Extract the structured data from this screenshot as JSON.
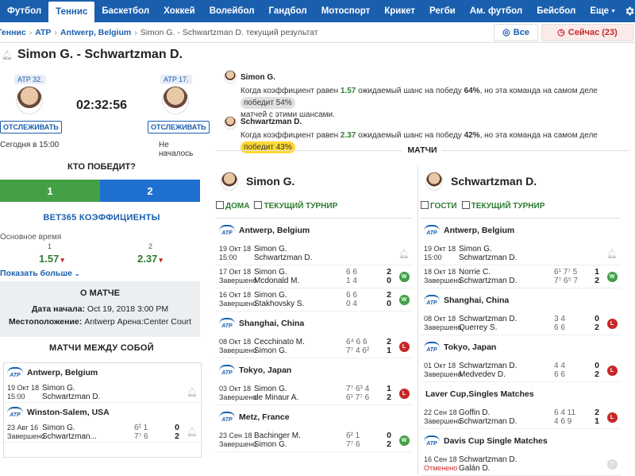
{
  "nav": {
    "tabs": [
      "Футбол",
      "Теннис",
      "Баскетбол",
      "Хоккей",
      "Волейбол",
      "Гандбол",
      "Мотоспорт",
      "Крикет",
      "Регби",
      "Ам. футбол",
      "Бейсбол",
      "Еще"
    ],
    "active": "Теннис",
    "more_icon": "caret-down-icon",
    "settings_icon": "gear-icon"
  },
  "breadcrumb": {
    "items": [
      "Теннис",
      "ATP",
      "Antwerp, Belgium"
    ],
    "current": "Simon G. - Schwartzman D. текущий результат"
  },
  "filters": {
    "all": "Все",
    "now": "Сейчас (23)"
  },
  "match": {
    "title": "Simon G. - Schwartzman D.",
    "time": "02:32:56",
    "home": {
      "rank": "ATP 32.",
      "follow": "ОТСЛЕЖИВАТЬ",
      "status": "Сегодня в 15:00"
    },
    "away": {
      "rank": "ATP 17.",
      "follow": "ОТСЛЕЖИВАТЬ",
      "status": "Не началось"
    }
  },
  "vote": {
    "title": "КТО ПОБЕДИТ?",
    "opt1": "1",
    "opt2": "2"
  },
  "odds": {
    "title": "BET365 КОЭФФИЦИЕНТЫ",
    "market": "Основное время",
    "h1": "1",
    "h2": "2",
    "v1": "1.57",
    "v2": "2.37",
    "show_more": "Показать больше"
  },
  "about": {
    "title": "О МАТЧЕ",
    "start_label": "Дата начала:",
    "start_value": "Oct 19, 2018 3:00 PM",
    "place_label": "Местоположение:",
    "place_value": "Antwerp Арена:Center Court"
  },
  "h2h": {
    "title": "МАТЧИ МЕЖДУ СОБОЙ",
    "groups": [
      {
        "tournament": "Antwerp, Belgium",
        "matches": [
          {
            "date": "19 Окт 18",
            "status": "15:00",
            "p1": "Simon G.",
            "p2": "Schwartzman D.",
            "s1": "",
            "s2": "",
            "t1": "",
            "t2": "",
            "res": "bell"
          }
        ]
      },
      {
        "tournament": "Winston-Salem, USA",
        "matches": [
          {
            "date": "23 Авг 16",
            "status": "Завершено",
            "p1": "Simon G.",
            "p2": "Schwartzman...",
            "s1": "6² 1",
            "s2": "7⁷ 6",
            "t1": "0",
            "t2": "2",
            "res": "bell"
          }
        ]
      }
    ]
  },
  "predictions": {
    "home": {
      "name": "Simon G.",
      "pre": "Когда коэффициент равен ",
      "odd": "1.57",
      "mid": " ожидаемый шанс на победу ",
      "chance": "64%",
      "post": ", но эта команда на самом деле ",
      "pill": "победит 54%",
      "tail": "матчей с этими шансами."
    },
    "away": {
      "name": "Schwartzman D.",
      "pre": "Когда коэффициент равен ",
      "odd": "2.37",
      "mid": " ожидаемый шанс на победу ",
      "chance": "42%",
      "post": ", но эта команда на самом деле ",
      "pill": "победит 43%"
    }
  },
  "matches_title": "МАТЧИ",
  "form": {
    "home": {
      "name": "Simon G.",
      "f1": "ДОМА",
      "f2": "ТЕКУЩИЙ ТУРНИР",
      "groups": [
        {
          "tournament": "Antwerp, Belgium",
          "matches": [
            {
              "date": "19 Окт 18",
              "status": "15:00",
              "p1": "Simon G.",
              "p2": "Schwartzman D.",
              "s1": "",
              "s2": "",
              "t1": "",
              "t2": "",
              "res": "bell"
            },
            {
              "date": "17 Окт 18",
              "status": "Завершено",
              "p1": "Simon G.",
              "p2": "Mcdonald M.",
              "s1": "6 6",
              "s2": "1 4",
              "t1": "2",
              "t2": "0",
              "res": "W"
            },
            {
              "date": "16 Окт 18",
              "status": "Завершено",
              "p1": "Simon G.",
              "p2": "Stakhovsky S.",
              "s1": "6 6",
              "s2": "0 4",
              "t1": "2",
              "t2": "0",
              "res": "W"
            }
          ]
        },
        {
          "tournament": "Shanghai, China",
          "matches": [
            {
              "date": "08 Окт 18",
              "status": "Завершено",
              "p1": "Cecchinato M.",
              "p2": "Simon G.",
              "s1": "6⁴ 6 6",
              "s2": "7⁷ 4 6²",
              "t1": "2",
              "t2": "1",
              "res": "L"
            }
          ]
        },
        {
          "tournament": "Tokyo, Japan",
          "matches": [
            {
              "date": "03 Окт 18",
              "status": "Завершено",
              "p1": "Simon G.",
              "p2": "de Minaur A.",
              "s1": "7⁷ 6³ 4",
              "s2": "6¹ 7⁷ 6",
              "t1": "1",
              "t2": "2",
              "res": "L"
            }
          ]
        },
        {
          "tournament": "Metz, France",
          "matches": [
            {
              "date": "23 Сен 18",
              "status": "Завершено",
              "p1": "Bachinger M.",
              "p2": "Simon G.",
              "s1": "6² 1",
              "s2": "7⁷ 6",
              "t1": "0",
              "t2": "2",
              "res": "W"
            }
          ]
        }
      ]
    },
    "away": {
      "name": "Schwartzman D.",
      "f1": "ГОСТИ",
      "f2": "ТЕКУЩИЙ ТУРНИР",
      "groups": [
        {
          "tournament": "Antwerp, Belgium",
          "matches": [
            {
              "date": "19 Окт 18",
              "status": "15:00",
              "p1": "Simon G.",
              "p2": "Schwartzman D.",
              "s1": "",
              "s2": "",
              "t1": "",
              "t2": "",
              "res": "bell"
            },
            {
              "date": "18 Окт 18",
              "status": "Завершено",
              "p1": "Norrie C.",
              "p2": "Schwartzman D.",
              "s1": "6¹ 7⁷ 5",
              "s2": "7⁷ 6⁵ 7",
              "t1": "1",
              "t2": "2",
              "res": "W"
            }
          ]
        },
        {
          "tournament": "Shanghai, China",
          "matches": [
            {
              "date": "08 Окт 18",
              "status": "Завершено",
              "p1": "Schwartzman D.",
              "p2": "Querrey S.",
              "s1": "3 4",
              "s2": "6 6",
              "t1": "0",
              "t2": "2",
              "res": "L"
            }
          ]
        },
        {
          "tournament": "Tokyo, Japan",
          "matches": [
            {
              "date": "01 Окт 18",
              "status": "Завершено",
              "p1": "Schwartzman D.",
              "p2": "Medvedev D.",
              "s1": "4 4",
              "s2": "6 6",
              "t1": "0",
              "t2": "2",
              "res": "L"
            }
          ]
        },
        {
          "tournament": "Laver Cup,Singles Matches",
          "matches": [
            {
              "date": "22 Сен 18",
              "status": "Завершено",
              "p1": "Goffin D.",
              "p2": "Schwartzman D.",
              "s1": "6 4 11",
              "s2": "4 6 9",
              "t1": "2",
              "t2": "1",
              "res": "L"
            }
          ]
        },
        {
          "tournament": "Davis Cup Single Matches",
          "matches": [
            {
              "date": "16 Сен 18",
              "status": "Отменено",
              "p1": "Schwartzman D.",
              "p2": "Galán D.",
              "s1": "",
              "s2": "",
              "t1": "",
              "t2": "",
              "res": "?"
            }
          ]
        }
      ]
    }
  },
  "colors": {
    "brand": "#1a5fae",
    "win": "#43a047",
    "loss": "#c62828",
    "vote2": "#1e6fd0"
  }
}
